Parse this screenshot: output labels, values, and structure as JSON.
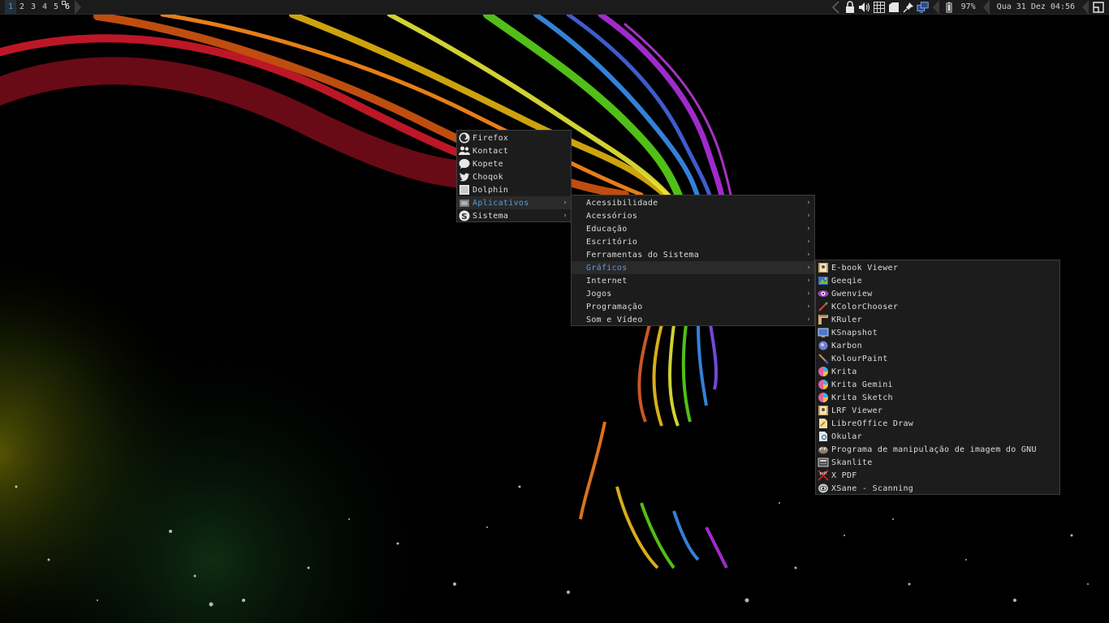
{
  "panel": {
    "desktops": [
      "1",
      "2",
      "3",
      "4",
      "5",
      "6"
    ],
    "active_desktop": "1",
    "tray_icons": [
      "arrow-left-icon",
      "lock-icon",
      "volume-icon",
      "calendar-grid-icon",
      "notes-icon",
      "pin-icon",
      "network-icon"
    ],
    "battery_icon": "battery-icon",
    "battery": "97%",
    "clock": "Qua 31 Dez 04:56",
    "end_icon": "window-layout-icon"
  },
  "main_menu": {
    "items": [
      {
        "label": "Firefox",
        "icon": "firefox-icon",
        "submenu": false
      },
      {
        "label": "Kontact",
        "icon": "contacts-icon",
        "submenu": false
      },
      {
        "label": "Kopete",
        "icon": "chat-bubble-icon",
        "submenu": false
      },
      {
        "label": "Choqok",
        "icon": "twitter-bird-icon",
        "submenu": false
      },
      {
        "label": "Dolphin",
        "icon": "file-manager-icon",
        "submenu": false
      },
      {
        "label": "Aplicativos",
        "icon": "applications-icon",
        "submenu": true,
        "highlighted": true
      },
      {
        "label": "Sistema",
        "icon": "system-icon",
        "submenu": true
      }
    ]
  },
  "apps_menu": {
    "items": [
      {
        "label": "Acessibilidade"
      },
      {
        "label": "Acessórios"
      },
      {
        "label": "Educação"
      },
      {
        "label": "Escritório"
      },
      {
        "label": "Ferramentas do Sistema"
      },
      {
        "label": "Gráficos",
        "highlighted": true
      },
      {
        "label": "Internet"
      },
      {
        "label": "Jogos"
      },
      {
        "label": "Programação"
      },
      {
        "label": "Som e Vídeo"
      }
    ],
    "submenu_glyph": "›"
  },
  "graphics_menu": {
    "items": [
      {
        "label": "E-book Viewer",
        "icon": "ebook-icon"
      },
      {
        "label": "Geeqie",
        "icon": "geeqie-icon"
      },
      {
        "label": "Gwenview",
        "icon": "gwenview-icon"
      },
      {
        "label": "KColorChooser",
        "icon": "color-picker-icon"
      },
      {
        "label": "KRuler",
        "icon": "ruler-icon"
      },
      {
        "label": "KSnapshot",
        "icon": "screenshot-icon"
      },
      {
        "label": "Karbon",
        "icon": "karbon-icon"
      },
      {
        "label": "KolourPaint",
        "icon": "paintbrush-icon"
      },
      {
        "label": "Krita",
        "icon": "krita-icon"
      },
      {
        "label": "Krita Gemini",
        "icon": "krita-icon"
      },
      {
        "label": "Krita Sketch",
        "icon": "krita-icon"
      },
      {
        "label": "LRF Viewer",
        "icon": "ebook-icon"
      },
      {
        "label": "LibreOffice Draw",
        "icon": "draw-icon"
      },
      {
        "label": "Okular",
        "icon": "document-viewer-icon"
      },
      {
        "label": "Programa de manipulação de imagem do GNU",
        "icon": "gimp-icon"
      },
      {
        "label": "Skanlite",
        "icon": "scanner-icon"
      },
      {
        "label": "X PDF",
        "icon": "pdf-icon"
      },
      {
        "label": "XSane - Scanning",
        "icon": "xsane-icon"
      }
    ]
  },
  "colors": {
    "panel_bg": "#1b1b1b",
    "menu_bg": "#1c1c1c",
    "highlight_text": "#5b9bd5",
    "menu_text": "#dcdcdc"
  }
}
